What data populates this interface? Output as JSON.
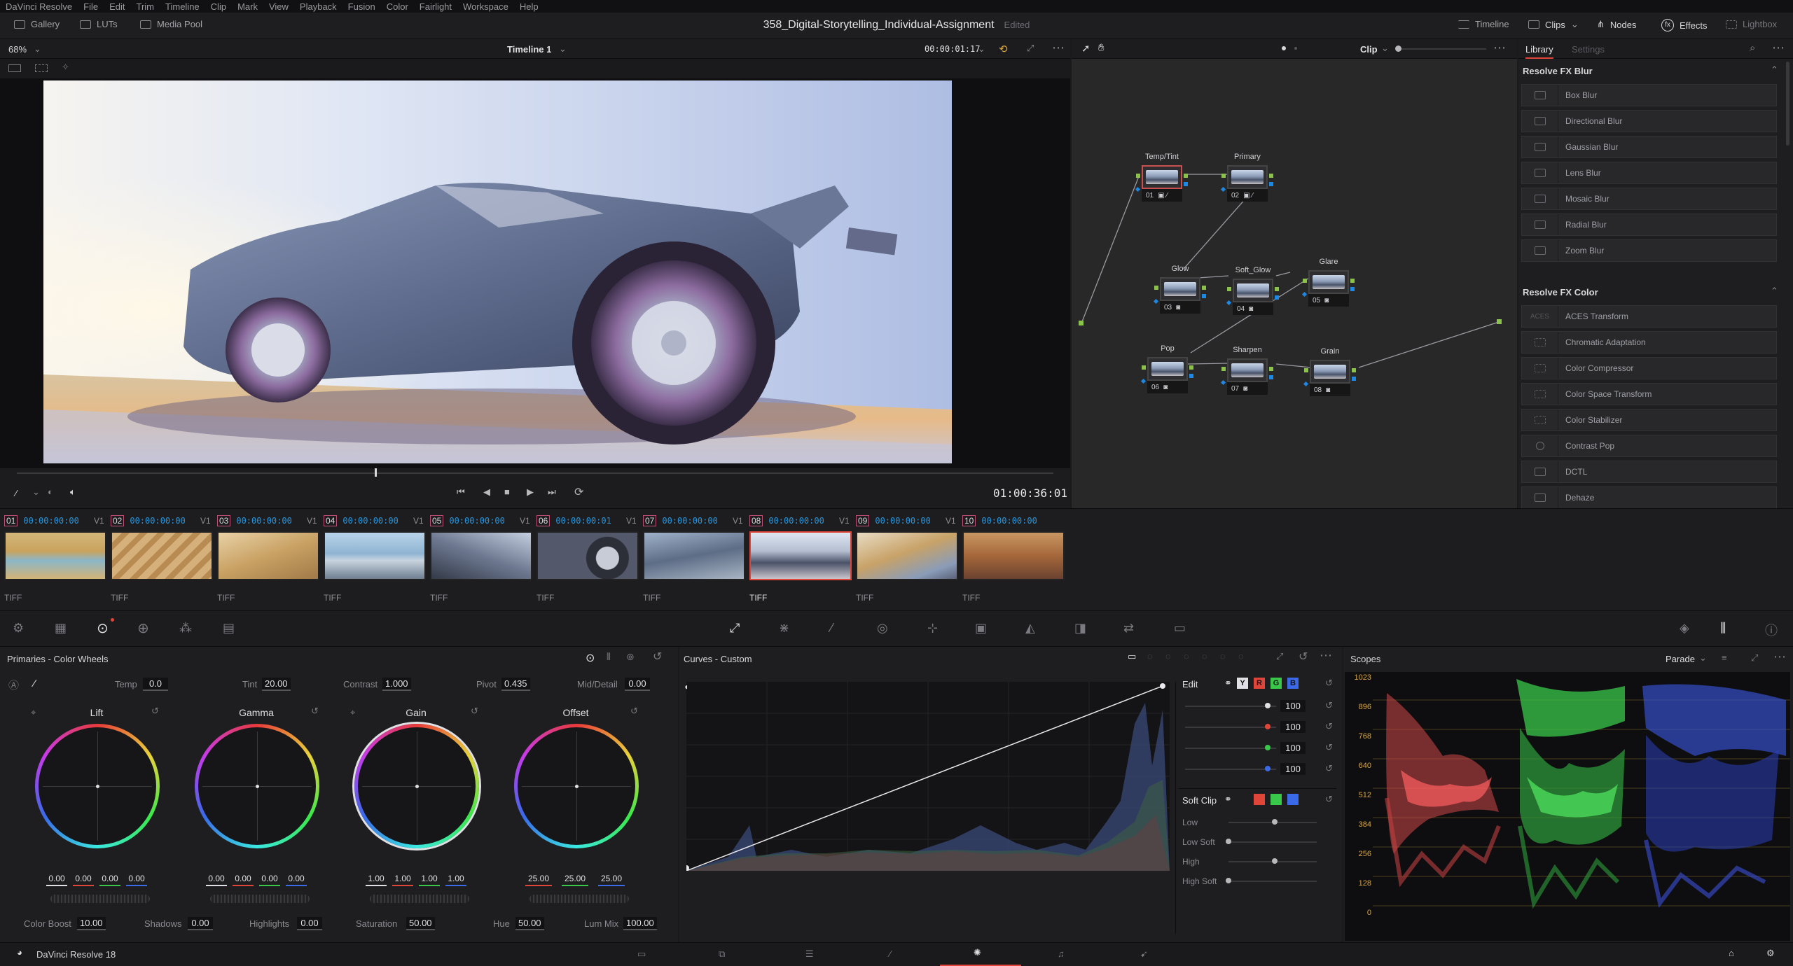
{
  "menu": [
    "DaVinci Resolve",
    "File",
    "Edit",
    "Trim",
    "Timeline",
    "Clip",
    "Mark",
    "View",
    "Playback",
    "Fusion",
    "Color",
    "Fairlight",
    "Workspace",
    "Help"
  ],
  "toolbar": {
    "gallery": "Gallery",
    "luts": "LUTs",
    "media_pool": "Media Pool",
    "project_title": "358_Digital-Storytelling_Individual-Assignment",
    "edited": "Edited",
    "timeline": "Timeline",
    "clips": "Clips",
    "nodes": "Nodes",
    "effects": "Effects",
    "lightbox": "Lightbox"
  },
  "viewer": {
    "zoom": "68%",
    "timeline_name": "Timeline 1",
    "timecode": "00:00:01:17",
    "playhead_tc": "01:00:36:01"
  },
  "node_editor": {
    "mode": "Clip",
    "nodes": [
      {
        "label": "Temp/Tint",
        "num": "01"
      },
      {
        "label": "Primary",
        "num": "02"
      },
      {
        "label": "Glow",
        "num": "03"
      },
      {
        "label": "Soft_Glow",
        "num": "04"
      },
      {
        "label": "Glare",
        "num": "05"
      },
      {
        "label": "Pop",
        "num": "06"
      },
      {
        "label": "Sharpen",
        "num": "07"
      },
      {
        "label": "Grain",
        "num": "08"
      }
    ]
  },
  "library": {
    "tab_library": "Library",
    "tab_settings": "Settings",
    "blur_header": "Resolve FX Blur",
    "blur_items": [
      "Box Blur",
      "Directional Blur",
      "Gaussian Blur",
      "Lens Blur",
      "Mosaic Blur",
      "Radial Blur",
      "Zoom Blur"
    ],
    "color_header": "Resolve FX Color",
    "color_items": [
      "ACES Transform",
      "Chromatic Adaptation",
      "Color Compressor",
      "Color Space Transform",
      "Color Stabilizer",
      "Contrast Pop",
      "DCTL",
      "Dehaze"
    ],
    "aces_icon_text": "ACES"
  },
  "clips": [
    {
      "num": "01",
      "tc": "00:00:00:00",
      "track": "V1",
      "type": "TIFF"
    },
    {
      "num": "02",
      "tc": "00:00:00:00",
      "track": "V1",
      "type": "TIFF"
    },
    {
      "num": "03",
      "tc": "00:00:00:00",
      "track": "V1",
      "type": "TIFF"
    },
    {
      "num": "04",
      "tc": "00:00:00:00",
      "track": "V1",
      "type": "TIFF"
    },
    {
      "num": "05",
      "tc": "00:00:00:00",
      "track": "V1",
      "type": "TIFF"
    },
    {
      "num": "06",
      "tc": "00:00:00:01",
      "track": "V1",
      "type": "TIFF"
    },
    {
      "num": "07",
      "tc": "00:00:00:00",
      "track": "V1",
      "type": "TIFF"
    },
    {
      "num": "08",
      "tc": "00:00:00:00",
      "track": "V1",
      "type": "TIFF"
    },
    {
      "num": "09",
      "tc": "00:00:00:00",
      "track": "V1",
      "type": "TIFF"
    },
    {
      "num": "10",
      "tc": "00:00:00:00",
      "track": "V1",
      "type": "TIFF"
    }
  ],
  "primaries": {
    "title": "Primaries - Color Wheels",
    "temp_label": "Temp",
    "temp": "0.0",
    "tint_label": "Tint",
    "tint": "20.00",
    "contrast_label": "Contrast",
    "contrast": "1.000",
    "pivot_label": "Pivot",
    "pivot": "0.435",
    "middetail_label": "Mid/Detail",
    "middetail": "0.00",
    "wheels": [
      {
        "name": "Lift",
        "vals": [
          "0.00",
          "0.00",
          "0.00",
          "0.00"
        ]
      },
      {
        "name": "Gamma",
        "vals": [
          "0.00",
          "0.00",
          "0.00",
          "0.00"
        ]
      },
      {
        "name": "Gain",
        "vals": [
          "1.00",
          "1.00",
          "1.00",
          "1.00"
        ]
      },
      {
        "name": "Offset",
        "vals": [
          "25.00",
          "25.00",
          "25.00"
        ]
      }
    ],
    "color_boost_label": "Color Boost",
    "color_boost": "10.00",
    "shadows_label": "Shadows",
    "shadows": "0.00",
    "highlights_label": "Highlights",
    "highlights": "0.00",
    "saturation_label": "Saturation",
    "saturation": "50.00",
    "hue_label": "Hue",
    "hue": "50.00",
    "lummix_label": "Lum Mix",
    "lummix": "100.00"
  },
  "curves": {
    "title": "Curves - Custom",
    "edit_label": "Edit",
    "channels": [
      "Y",
      "R",
      "G",
      "B"
    ],
    "edit_vals": [
      "100",
      "100",
      "100",
      "100"
    ],
    "softclip_label": "Soft Clip",
    "softclip_rows": [
      "Low",
      "Low Soft",
      "High",
      "High Soft"
    ]
  },
  "scopes": {
    "title": "Scopes",
    "mode": "Parade",
    "axis": [
      "1023",
      "896",
      "768",
      "640",
      "512",
      "384",
      "256",
      "128",
      "0"
    ]
  },
  "bottom": {
    "app_name": "DaVinci Resolve 18"
  },
  "colors": {
    "accent_red": "#e0453a",
    "timecode_blue": "#2a94d9",
    "clip_num_border": "#c0507a",
    "node_green": "#8bc34a",
    "node_blue": "#1e88e5"
  }
}
